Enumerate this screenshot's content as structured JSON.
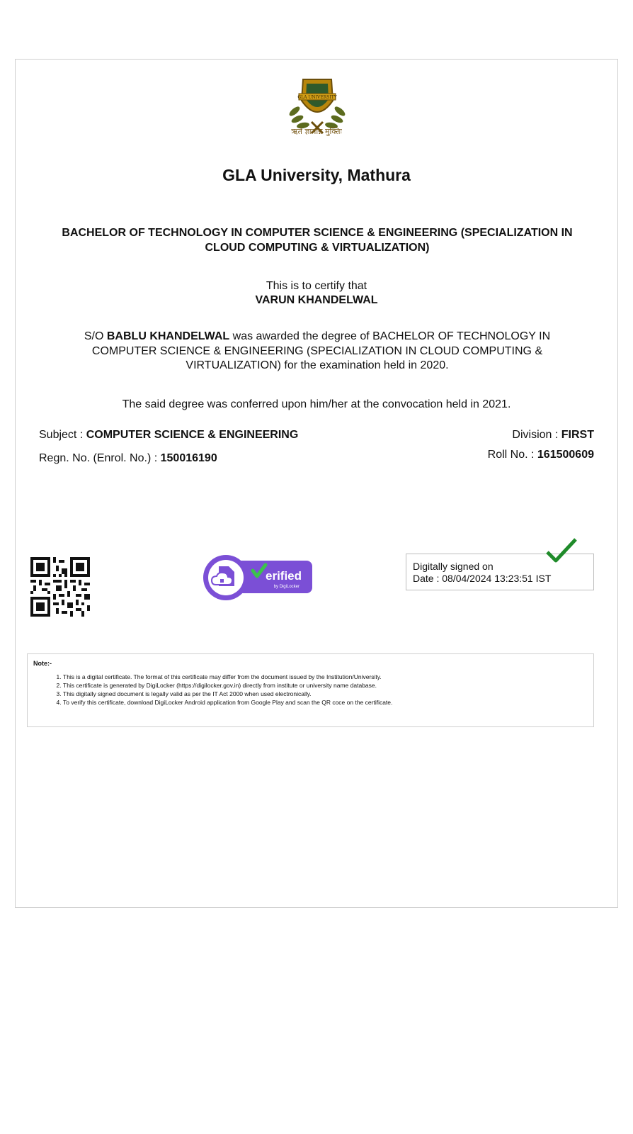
{
  "logo": {
    "motto": "ऋते ज्ञानान्न मुक्तिः",
    "emblem_text": "GLA UNIVERSITY"
  },
  "university": "GLA University, Mathura",
  "degree_title": "BACHELOR OF TECHNOLOGY IN COMPUTER SCIENCE & ENGINEERING (SPECIALIZATION IN CLOUD COMPUTING & VIRTUALIZATION)",
  "certify_text": "This is to certify that",
  "student_name": "VARUN KHANDELWAL",
  "award": {
    "prefix": "S/O ",
    "parent_name": "BABLU KHANDELWAL",
    "text": " was awarded the degree of BACHELOR OF TECHNOLOGY IN COMPUTER SCIENCE & ENGINEERING (SPECIALIZATION IN CLOUD COMPUTING & VIRTUALIZATION) for the examination held in 2020."
  },
  "conferred_text": "The said degree was conferred upon him/her at the convocation held in 2021.",
  "details": {
    "subject_label": "Subject : ",
    "subject_value": "COMPUTER SCIENCE & ENGINEERING",
    "division_label": "Division : ",
    "division_value": "FIRST",
    "regn_label": "Regn. No. (Enrol. No.) : ",
    "regn_value": "150016190",
    "roll_label": "Roll No. : ",
    "roll_value": "161500609"
  },
  "verified_badge": {
    "main": "erified",
    "sub": "by DigiLocker"
  },
  "signature": {
    "line1": "Digitally signed on",
    "line2": "Date : 08/04/2024 13:23:51 IST"
  },
  "note": {
    "title": "Note:-",
    "items": [
      "This is a digital certificate. The format of this certificate may differ from the document issued by the Institution/University.",
      "This certificate is generated by DigiLocker (https://digilocker.gov.in) directly from institute or university name database.",
      "This digitally signed document is legally valid as per the IT Act 2000 when used electronically.",
      "To verify this certificate, download DigiLocker Android application from Google Play and scan the QR coce on the certificate."
    ]
  },
  "colors": {
    "badge_purple": "#7b4fd6",
    "badge_green": "#3cc24b",
    "tick_green": "#1f8b2a",
    "border": "#cfcfcf"
  }
}
